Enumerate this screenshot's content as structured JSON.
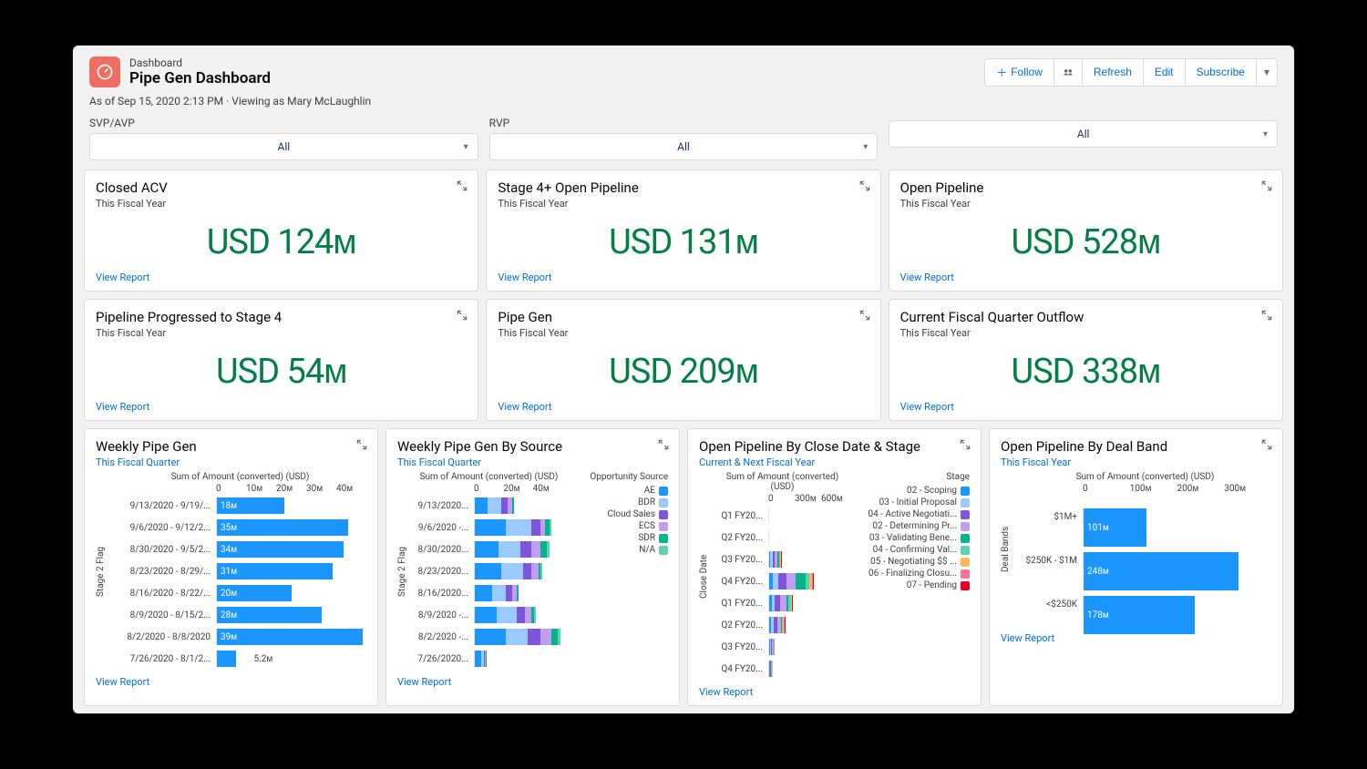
{
  "header": {
    "obj_label": "Dashboard",
    "title": "Pipe Gen Dashboard",
    "follow": "Follow",
    "refresh": "Refresh",
    "edit": "Edit",
    "subscribe": "Subscribe"
  },
  "meta": {
    "line": "As of Sep 15, 2020 2:13 PM · Viewing as Mary McLaughlin"
  },
  "filters": [
    {
      "label": "SVP/AVP",
      "value": "All"
    },
    {
      "label": "RVP",
      "value": "All"
    },
    {
      "label": "",
      "value": "All"
    }
  ],
  "kpis": [
    {
      "title": "Closed ACV",
      "sub": "This Fiscal Year",
      "value": "USD 124ᴍ"
    },
    {
      "title": "Stage 4+ Open Pipeline",
      "sub": "This Fiscal Year",
      "value": "USD 131ᴍ"
    },
    {
      "title": "Open Pipeline",
      "sub": "This Fiscal Year",
      "value": "USD 528ᴍ"
    },
    {
      "title": "Pipeline Progressed to Stage 4",
      "sub": "This Fiscal Year",
      "value": "USD 54ᴍ"
    },
    {
      "title": "Pipe Gen",
      "sub": "This Fiscal Year",
      "value": "USD 209ᴍ"
    },
    {
      "title": "Current Fiscal Quarter Outflow",
      "sub": "This Fiscal Year",
      "value": "USD 338ᴍ"
    }
  ],
  "view_report": "View Report",
  "charts": {
    "weekly_pipe_gen": {
      "title": "Weekly Pipe Gen",
      "sub": "This Fiscal Quarter",
      "axis": "Sum of Amount (converted) (USD)",
      "yaxis": "Stage 2 Flag",
      "ticks": [
        "0",
        "10ᴍ",
        "20ᴍ",
        "30ᴍ",
        "40ᴍ"
      ]
    },
    "weekly_pipe_gen_source": {
      "title": "Weekly Pipe Gen By Source",
      "sub": "This Fiscal Quarter",
      "axis": "Sum of Amount (converted) (USD)",
      "yaxis": "Stage 2 Flag",
      "ticks": [
        "0",
        "20ᴍ",
        "40ᴍ"
      ],
      "legend_title": "Opportunity Source"
    },
    "open_by_close_date": {
      "title": "Open Pipeline By Close Date & Stage",
      "sub": "Current & Next Fiscal Year",
      "axis": "Sum of Amount (converted) (USD)",
      "yaxis": "Close Date",
      "ticks": [
        "0",
        "300ᴍ",
        "600ᴍ"
      ],
      "legend_title": "Stage"
    },
    "open_by_deal_band": {
      "title": "Open Pipeline By Deal Band",
      "sub": "This Fiscal Year",
      "axis": "Sum of Amount (converted) (USD)",
      "yaxis": "Deal Bands",
      "ticks": [
        "0",
        "100ᴍ",
        "200ᴍ",
        "300ᴍ"
      ]
    }
  },
  "chart_data": [
    {
      "type": "bar",
      "title": "Weekly Pipe Gen",
      "xlabel": "Sum of Amount (converted) (USD)",
      "ylabel": "Stage 2 Flag",
      "xlim": [
        0,
        40
      ],
      "unit": "M USD",
      "categories": [
        "9/13/2020 - 9/19/...",
        "9/6/2020 - 9/12/2...",
        "8/30/2020 - 9/5/2...",
        "8/23/2020 - 8/29/...",
        "8/16/2020 - 8/22/...",
        "8/9/2020 - 8/15/2...",
        "8/2/2020 - 8/8/2020",
        "7/26/2020 - 8/1/2..."
      ],
      "values": [
        18,
        35,
        34,
        31,
        20,
        28,
        39,
        5.2
      ],
      "value_labels": [
        "18ᴍ",
        "35ᴍ",
        "34ᴍ",
        "31ᴍ",
        "20ᴍ",
        "28ᴍ",
        "39ᴍ",
        "5.2ᴍ"
      ]
    },
    {
      "type": "bar",
      "stacked": true,
      "title": "Weekly Pipe Gen By Source",
      "xlabel": "Sum of Amount (converted) (USD)",
      "ylabel": "Stage 2 Flag",
      "xlim": [
        0,
        40
      ],
      "unit": "M USD",
      "categories": [
        "9/13/2020...",
        "9/6/2020 -...",
        "8/30/2020...",
        "8/23/2020...",
        "8/16/2020...",
        "8/9/2020 -...",
        "8/2/2020 -...",
        "7/26/2020..."
      ],
      "series": [
        {
          "name": "AE",
          "color": "#1b96ff",
          "values": [
            6,
            14,
            11,
            12,
            8,
            10,
            14,
            3
          ]
        },
        {
          "name": "BDR",
          "color": "#9bcaff",
          "values": [
            6,
            12,
            10,
            10,
            6,
            9,
            10,
            1
          ]
        },
        {
          "name": "Cloud Sales",
          "color": "#7f56d9",
          "values": [
            3,
            4,
            5,
            4,
            3,
            4,
            6,
            0.5
          ]
        },
        {
          "name": "ECS",
          "color": "#c29ef1",
          "values": [
            2,
            2,
            4,
            3,
            2,
            3,
            5,
            0.5
          ]
        },
        {
          "name": "SDR",
          "color": "#04b388",
          "values": [
            1,
            2,
            3,
            1,
            1,
            1,
            3,
            0.2
          ]
        },
        {
          "name": "N/A",
          "color": "#5fd2b1",
          "values": [
            0,
            1,
            1,
            1,
            0,
            1,
            1,
            0
          ]
        }
      ]
    },
    {
      "type": "bar",
      "stacked": true,
      "title": "Open Pipeline By Close Date & Stage",
      "xlabel": "Sum of Amount (converted) (USD)",
      "ylabel": "Close Date",
      "xlim": [
        0,
        600
      ],
      "unit": "M USD",
      "categories": [
        "Q1 FY20...",
        "Q2 FY20...",
        "Q3 FY20...",
        "Q4 FY20...",
        "Q1 FY20...",
        "Q2 FY20...",
        "Q3 FY20...",
        "Q4 FY20..."
      ],
      "series": [
        {
          "name": "02 - Scoping",
          "color": "#1b96ff",
          "values": [
            0,
            0,
            10,
            30,
            20,
            15,
            8,
            5
          ]
        },
        {
          "name": "03 - Initial Proposal",
          "color": "#9bcaff",
          "values": [
            0,
            0,
            15,
            40,
            25,
            20,
            5,
            3
          ]
        },
        {
          "name": "04 - Active Negotiati...",
          "color": "#7f56d9",
          "values": [
            0,
            0,
            20,
            60,
            40,
            30,
            8,
            4
          ]
        },
        {
          "name": "02 - Determining Pr...",
          "color": "#c29ef1",
          "values": [
            0,
            0,
            20,
            70,
            45,
            25,
            6,
            3
          ]
        },
        {
          "name": "03 - Validating Bene...",
          "color": "#04b388",
          "values": [
            0,
            0,
            10,
            80,
            20,
            10,
            3,
            2
          ]
        },
        {
          "name": "04 - Confirming Val...",
          "color": "#5fd2b1",
          "values": [
            0,
            0,
            8,
            30,
            15,
            8,
            2,
            1
          ]
        },
        {
          "name": "05 - Negotiating $$ ...",
          "color": "#ffb75d",
          "values": [
            0,
            0,
            5,
            15,
            8,
            5,
            1,
            1
          ]
        },
        {
          "name": "06 - Finalizing Closu...",
          "color": "#fe7298",
          "values": [
            0,
            0,
            4,
            10,
            5,
            3,
            1,
            0
          ]
        },
        {
          "name": "07 - Pending",
          "color": "#ea001e",
          "values": [
            0,
            0,
            3,
            5,
            3,
            2,
            0,
            0
          ]
        }
      ]
    },
    {
      "type": "bar",
      "title": "Open Pipeline By Deal Band",
      "xlabel": "Sum of Amount (converted) (USD)",
      "ylabel": "Deal Bands",
      "xlim": [
        0,
        300
      ],
      "unit": "M USD",
      "categories": [
        "$1M+",
        "$250K - $1M",
        "<$250K"
      ],
      "values": [
        101,
        248,
        178
      ],
      "value_labels": [
        "101ᴍ",
        "248ᴍ",
        "178ᴍ"
      ]
    }
  ]
}
